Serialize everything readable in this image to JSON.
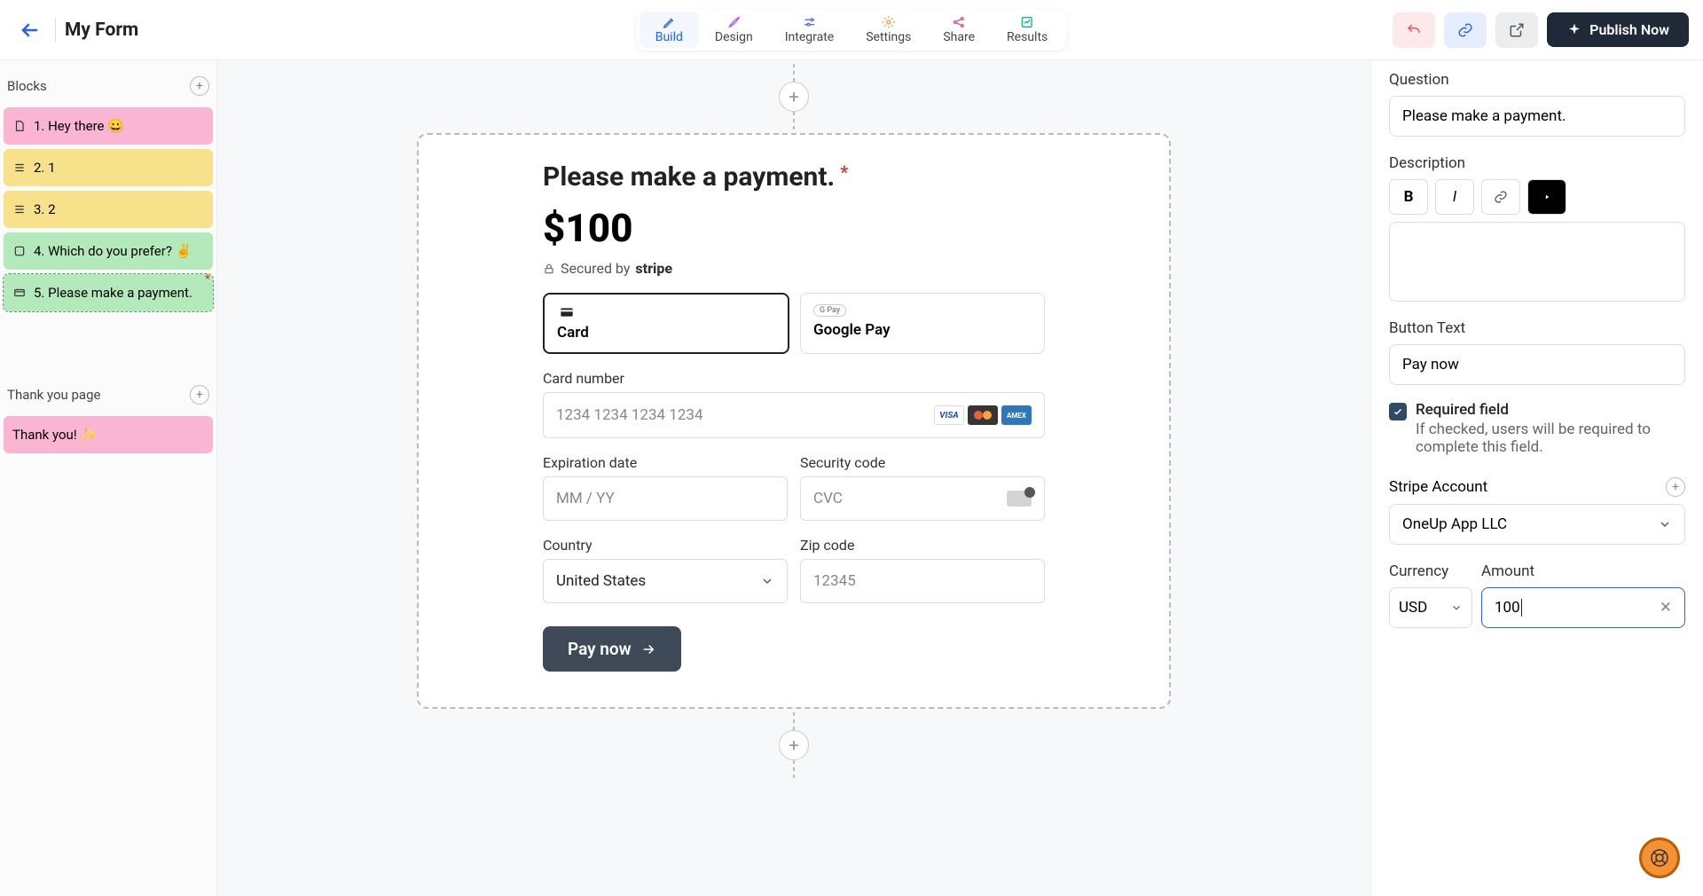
{
  "header": {
    "title": "My Form",
    "tabs": [
      "Build",
      "Design",
      "Integrate",
      "Settings",
      "Share",
      "Results"
    ],
    "active_tab": 0,
    "publish_label": "Publish Now"
  },
  "sidebar": {
    "blocks_label": "Blocks",
    "blocks": [
      {
        "label": "1. Hey there 😀",
        "color": "pink",
        "icon": "file"
      },
      {
        "label": "2. 1",
        "color": "yellow",
        "icon": "list"
      },
      {
        "label": "3. 2",
        "color": "yellow",
        "icon": "list"
      },
      {
        "label": "4. Which do you prefer? ✌️",
        "color": "green",
        "icon": "checkbox"
      },
      {
        "label": "5. Please make a payment.",
        "color": "green",
        "icon": "card",
        "selected": true,
        "required": true
      }
    ],
    "thank_you_label": "Thank you page",
    "thank_you_item": "Thank you! ✨"
  },
  "canvas": {
    "title": "Please make a payment.",
    "amount_display": "$100",
    "secured_prefix": "Secured by",
    "secured_brand": "stripe",
    "methods": {
      "card": "Card",
      "gpay": "Google Pay",
      "gpay_badge": "G Pay"
    },
    "fields": {
      "card_number_label": "Card number",
      "card_number_ph": "1234 1234 1234 1234",
      "exp_label": "Expiration date",
      "exp_ph": "MM / YY",
      "cvc_label": "Security code",
      "cvc_ph": "CVC",
      "country_label": "Country",
      "country_value": "United States",
      "zip_label": "Zip code",
      "zip_ph": "12345"
    },
    "pay_button": "Pay now"
  },
  "panel": {
    "question_label": "Question",
    "question_value": "Please make a payment.",
    "description_label": "Description",
    "button_text_label": "Button Text",
    "button_text_value": "Pay now",
    "required_title": "Required field",
    "required_desc": "If checked, users will be required to complete this field.",
    "stripe_label": "Stripe Account",
    "stripe_value": "OneUp App LLC",
    "currency_label": "Currency",
    "currency_value": "USD",
    "amount_label": "Amount",
    "amount_value": "100"
  }
}
